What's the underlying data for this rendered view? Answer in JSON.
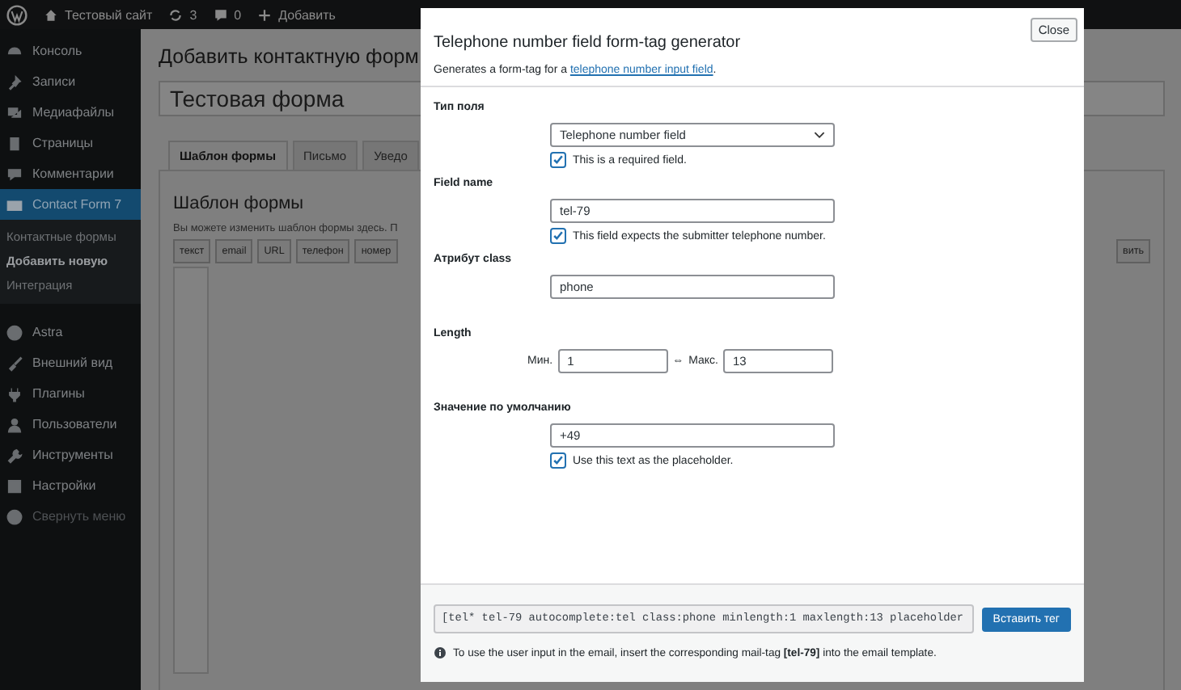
{
  "admin_bar": {
    "site_name": "Тестовый сайт",
    "updates_count": "3",
    "comments_count": "0",
    "new_label": "Добавить"
  },
  "sidebar": {
    "items": [
      {
        "label": "Консоль",
        "selected": false
      },
      {
        "label": "Записи",
        "selected": false
      },
      {
        "label": "Медиафайлы",
        "selected": false
      },
      {
        "label": "Страницы",
        "selected": false
      },
      {
        "label": "Комментарии",
        "selected": false
      },
      {
        "label": "Contact Form 7",
        "selected": true,
        "children": [
          {
            "label": "Контактные формы",
            "selected": false
          },
          {
            "label": "Добавить новую",
            "selected": true
          },
          {
            "label": "Интеграция",
            "selected": false
          }
        ]
      },
      {
        "label": "Astra",
        "selected": false
      },
      {
        "label": "Внешний вид",
        "selected": false
      },
      {
        "label": "Плагины",
        "selected": false
      },
      {
        "label": "Пользователи",
        "selected": false
      },
      {
        "label": "Инструменты",
        "selected": false
      },
      {
        "label": "Настройки",
        "selected": false
      },
      {
        "label": "Свернуть меню",
        "selected": false
      }
    ]
  },
  "page": {
    "title": "Добавить контактную форм",
    "form_title": "Тестовая форма",
    "tabs": [
      {
        "label": "Шаблон формы",
        "selected": true
      },
      {
        "label": "Письмо",
        "selected": false
      },
      {
        "label": "Уведо",
        "selected": false
      }
    ],
    "section_title": "Шаблон формы",
    "description": "Вы можете изменить шаблон формы здесь. П",
    "tag_buttons": [
      "текст",
      "email",
      "URL",
      "телефон",
      "номер"
    ],
    "side_button": "вить"
  },
  "modal": {
    "title": "Telephone number field form-tag generator",
    "close": "Close",
    "description": {
      "before": "Generates a form-tag for a ",
      "link": "telephone number input field",
      "after": "."
    },
    "rows": [
      {
        "kind": "select",
        "label": "Тип поля",
        "value": "Telephone number field",
        "checkbox": {
          "label": "This is a required field.",
          "checked": true
        }
      },
      {
        "kind": "text",
        "label": "Field name",
        "value": "tel-79",
        "checkbox": {
          "label": "This field expects the submitter telephone number.",
          "checked": true
        }
      },
      {
        "kind": "text",
        "label": "Атрибут class",
        "value": "phone"
      },
      {
        "kind": "range",
        "label": "Length",
        "min_label": "Мин.",
        "min_value": "1",
        "separator": "⇔",
        "max_label": "Макс.",
        "max_value": "13"
      },
      {
        "kind": "text",
        "label": "Значение по умолчанию",
        "value": "+49",
        "checkbox": {
          "label": "Use this text as the placeholder.",
          "checked": true
        }
      }
    ],
    "tag_code": "[tel* tel-79 autocomplete:tel class:phone minlength:1 maxlength:13 placeholder",
    "insert_button": "Вставить тег",
    "note": "To use the user input in the email, insert the corresponding mail-tag **[tel-79]** into the email template."
  }
}
